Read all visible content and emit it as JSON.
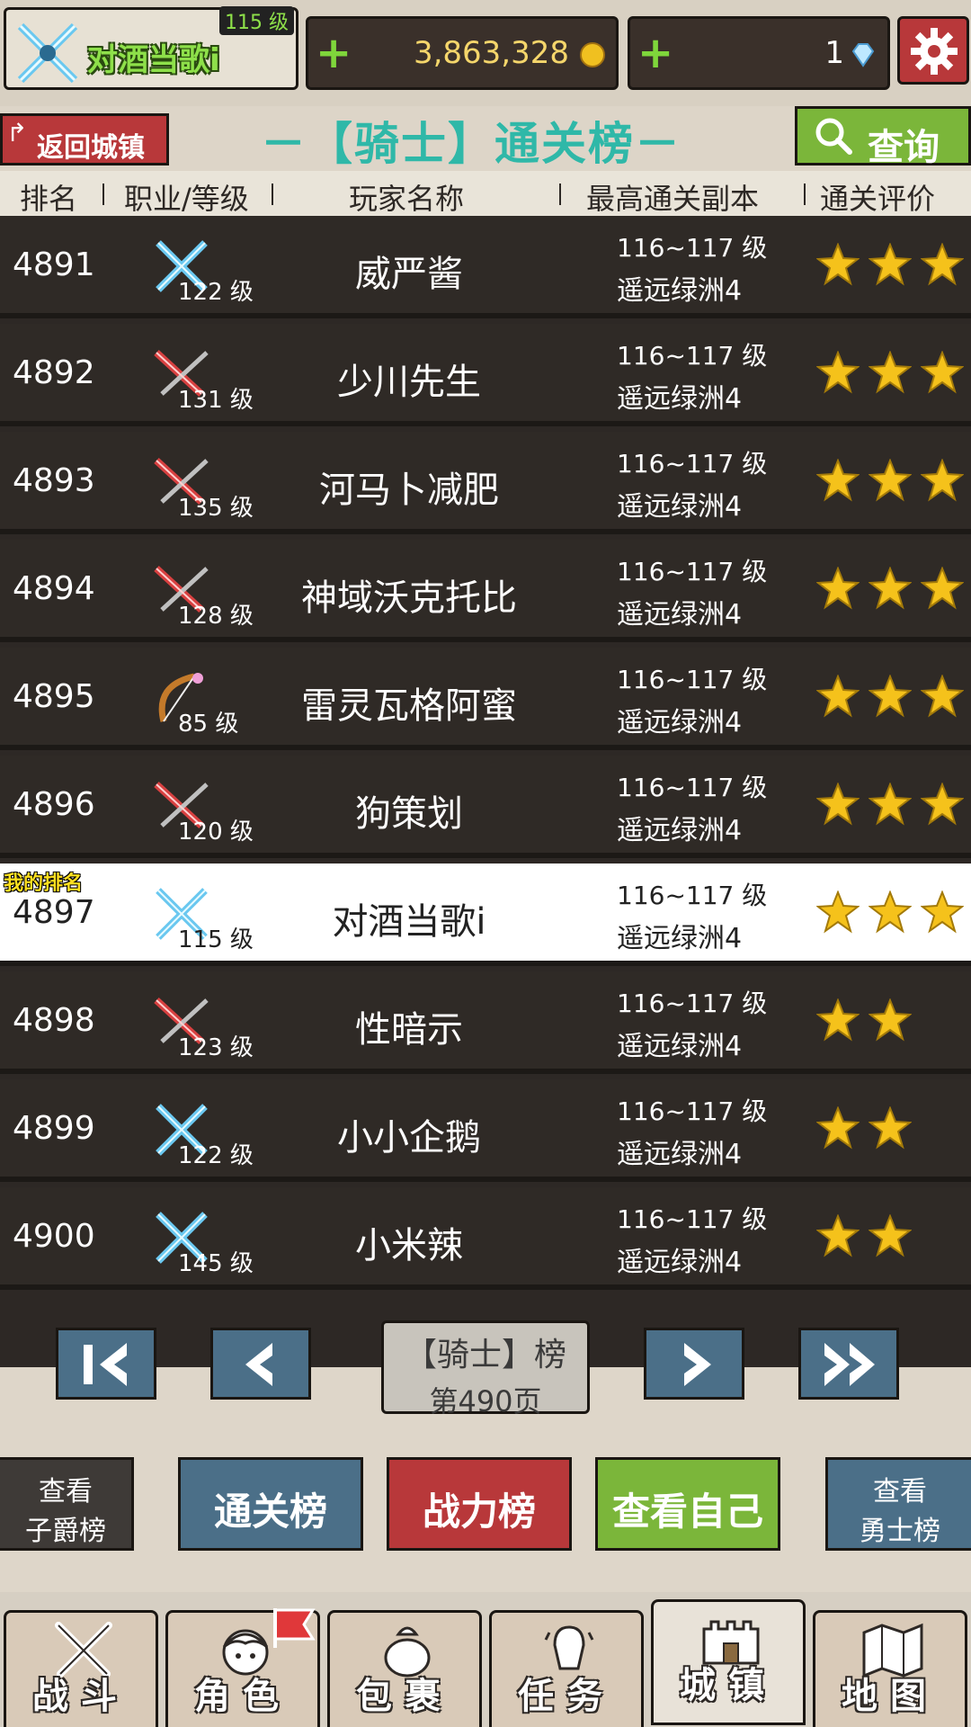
{
  "player": {
    "name": "对酒当歌i",
    "level": "115 级"
  },
  "currency": {
    "gold": "3,863,328",
    "gems": "1"
  },
  "header": {
    "back_label": "返回城镇",
    "title": "－【骑士】通关榜－",
    "query_label": "查询"
  },
  "columns": [
    "排名",
    "职业/等级",
    "玩家名称",
    "最高通关副本",
    "通关评价"
  ],
  "rows": [
    {
      "rank": "4891",
      "cls": "knight",
      "level": "122 级",
      "name": "威严酱",
      "dungeon_level": "116~117 级",
      "dungeon": "遥远绿洲4",
      "stars": 3,
      "mine": false
    },
    {
      "rank": "4892",
      "cls": "warrior",
      "level": "131 级",
      "name": "少川先生",
      "dungeon_level": "116~117 级",
      "dungeon": "遥远绿洲4",
      "stars": 3,
      "mine": false
    },
    {
      "rank": "4893",
      "cls": "warrior",
      "level": "135 级",
      "name": "河马卜减肥",
      "dungeon_level": "116~117 级",
      "dungeon": "遥远绿洲4",
      "stars": 3,
      "mine": false
    },
    {
      "rank": "4894",
      "cls": "warrior",
      "level": "128 级",
      "name": "神域沃克托比",
      "dungeon_level": "116~117 级",
      "dungeon": "遥远绿洲4",
      "stars": 3,
      "mine": false
    },
    {
      "rank": "4895",
      "cls": "archer",
      "level": "85 级",
      "name": "雷灵瓦格阿蜜",
      "dungeon_level": "116~117 级",
      "dungeon": "遥远绿洲4",
      "stars": 3,
      "mine": false
    },
    {
      "rank": "4896",
      "cls": "warrior",
      "level": "120 级",
      "name": "狗策划",
      "dungeon_level": "116~117 级",
      "dungeon": "遥远绿洲4",
      "stars": 3,
      "mine": false
    },
    {
      "rank": "4897",
      "cls": "knight",
      "level": "115 级",
      "name": "对酒当歌i",
      "dungeon_level": "116~117 级",
      "dungeon": "遥远绿洲4",
      "stars": 3,
      "mine": true,
      "mine_tag": "我的排名"
    },
    {
      "rank": "4898",
      "cls": "warrior",
      "level": "123 级",
      "name": "性暗示",
      "dungeon_level": "116~117 级",
      "dungeon": "遥远绿洲4",
      "stars": 2,
      "mine": false
    },
    {
      "rank": "4899",
      "cls": "knight",
      "level": "122 级",
      "name": "小小企鹅",
      "dungeon_level": "116~117 级",
      "dungeon": "遥远绿洲4",
      "stars": 2,
      "mine": false
    },
    {
      "rank": "4900",
      "cls": "knight",
      "level": "145 级",
      "name": "小米辣",
      "dungeon_level": "116~117 级",
      "dungeon": "遥远绿洲4",
      "stars": 2,
      "mine": false
    }
  ],
  "pager": {
    "line1": "【骑士】榜",
    "line2": "第490页"
  },
  "actions": {
    "view_baron_l1": "查看",
    "view_baron_l2": "子爵榜",
    "clear_board": "通关榜",
    "power_board": "战力榜",
    "view_self": "查看自己",
    "view_warrior_l1": "查看",
    "view_warrior_l2": "勇士榜"
  },
  "nav": [
    {
      "label": "战斗",
      "icon": "crossed-swords-icon"
    },
    {
      "label": "角色",
      "icon": "character-face-icon"
    },
    {
      "label": "包裹",
      "icon": "bag-icon"
    },
    {
      "label": "任务",
      "icon": "quest-icon"
    },
    {
      "label": "城镇",
      "icon": "castle-icon"
    },
    {
      "label": "地图",
      "icon": "map-icon"
    }
  ],
  "colors": {
    "red": "#b8383a",
    "blue": "#4b6f88",
    "green": "#7bb63a",
    "title": "#2fb8a8",
    "star": "#f5c21b"
  }
}
